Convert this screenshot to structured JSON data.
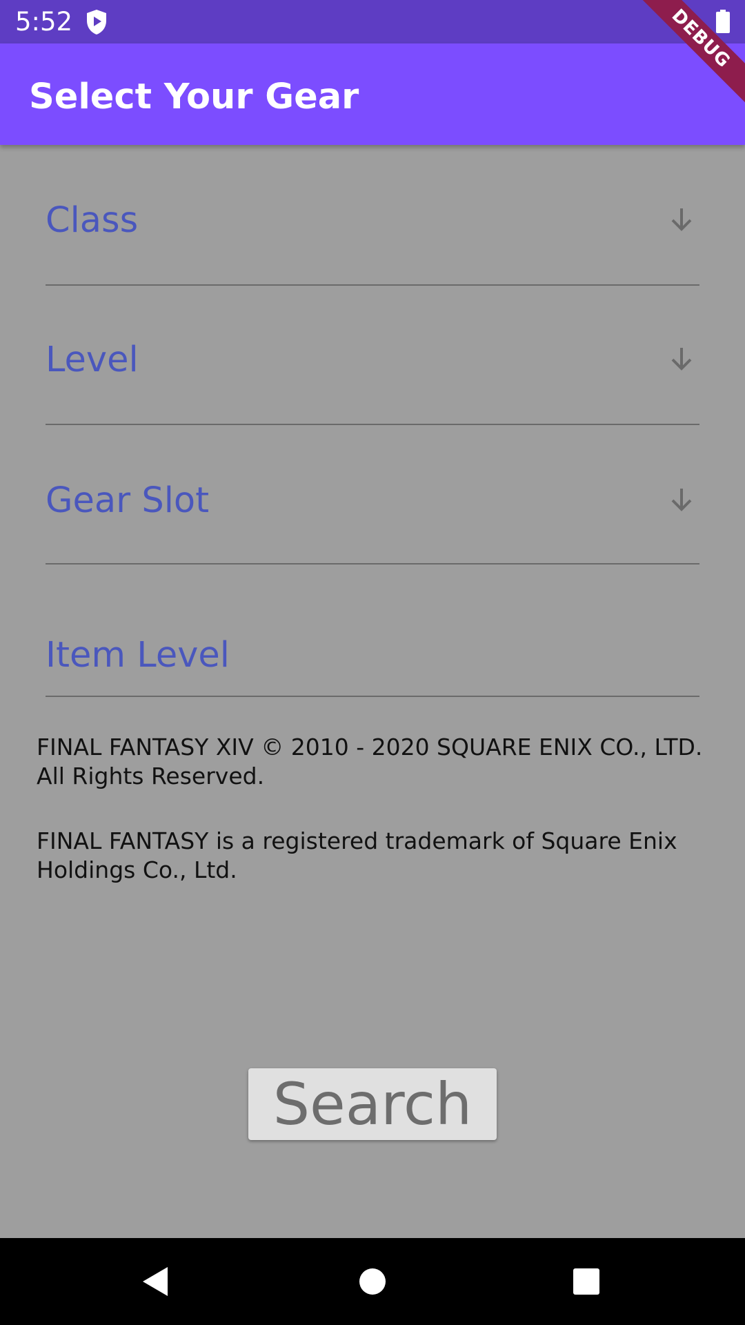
{
  "status_bar": {
    "time": "5:52",
    "icons": [
      "shield-play-icon",
      "battery-icon"
    ]
  },
  "app_bar": {
    "title": "Select Your Gear",
    "background": "#7c4dff"
  },
  "debug_banner": "DEBUG",
  "form": {
    "fields": [
      {
        "label": "Class",
        "type": "dropdown",
        "icon": "arrow-down-icon"
      },
      {
        "label": "Level",
        "type": "dropdown",
        "icon": "arrow-down-icon"
      },
      {
        "label": "Gear Slot",
        "type": "dropdown",
        "icon": "arrow-down-icon"
      },
      {
        "label": "Item Level",
        "type": "text-input"
      }
    ],
    "label_color": "#4a57bd"
  },
  "legal": {
    "copyright": "FINAL FANTASY XIV © 2010 - 2020 SQUARE ENIX CO., LTD. All Rights Reserved.",
    "trademark": "FINAL FANTASY is a registered trademark of Square Enix Holdings Co., Ltd."
  },
  "search_button": {
    "label": "Search"
  },
  "nav_bar": {
    "icons": [
      "back-icon",
      "home-icon",
      "recents-icon"
    ]
  }
}
